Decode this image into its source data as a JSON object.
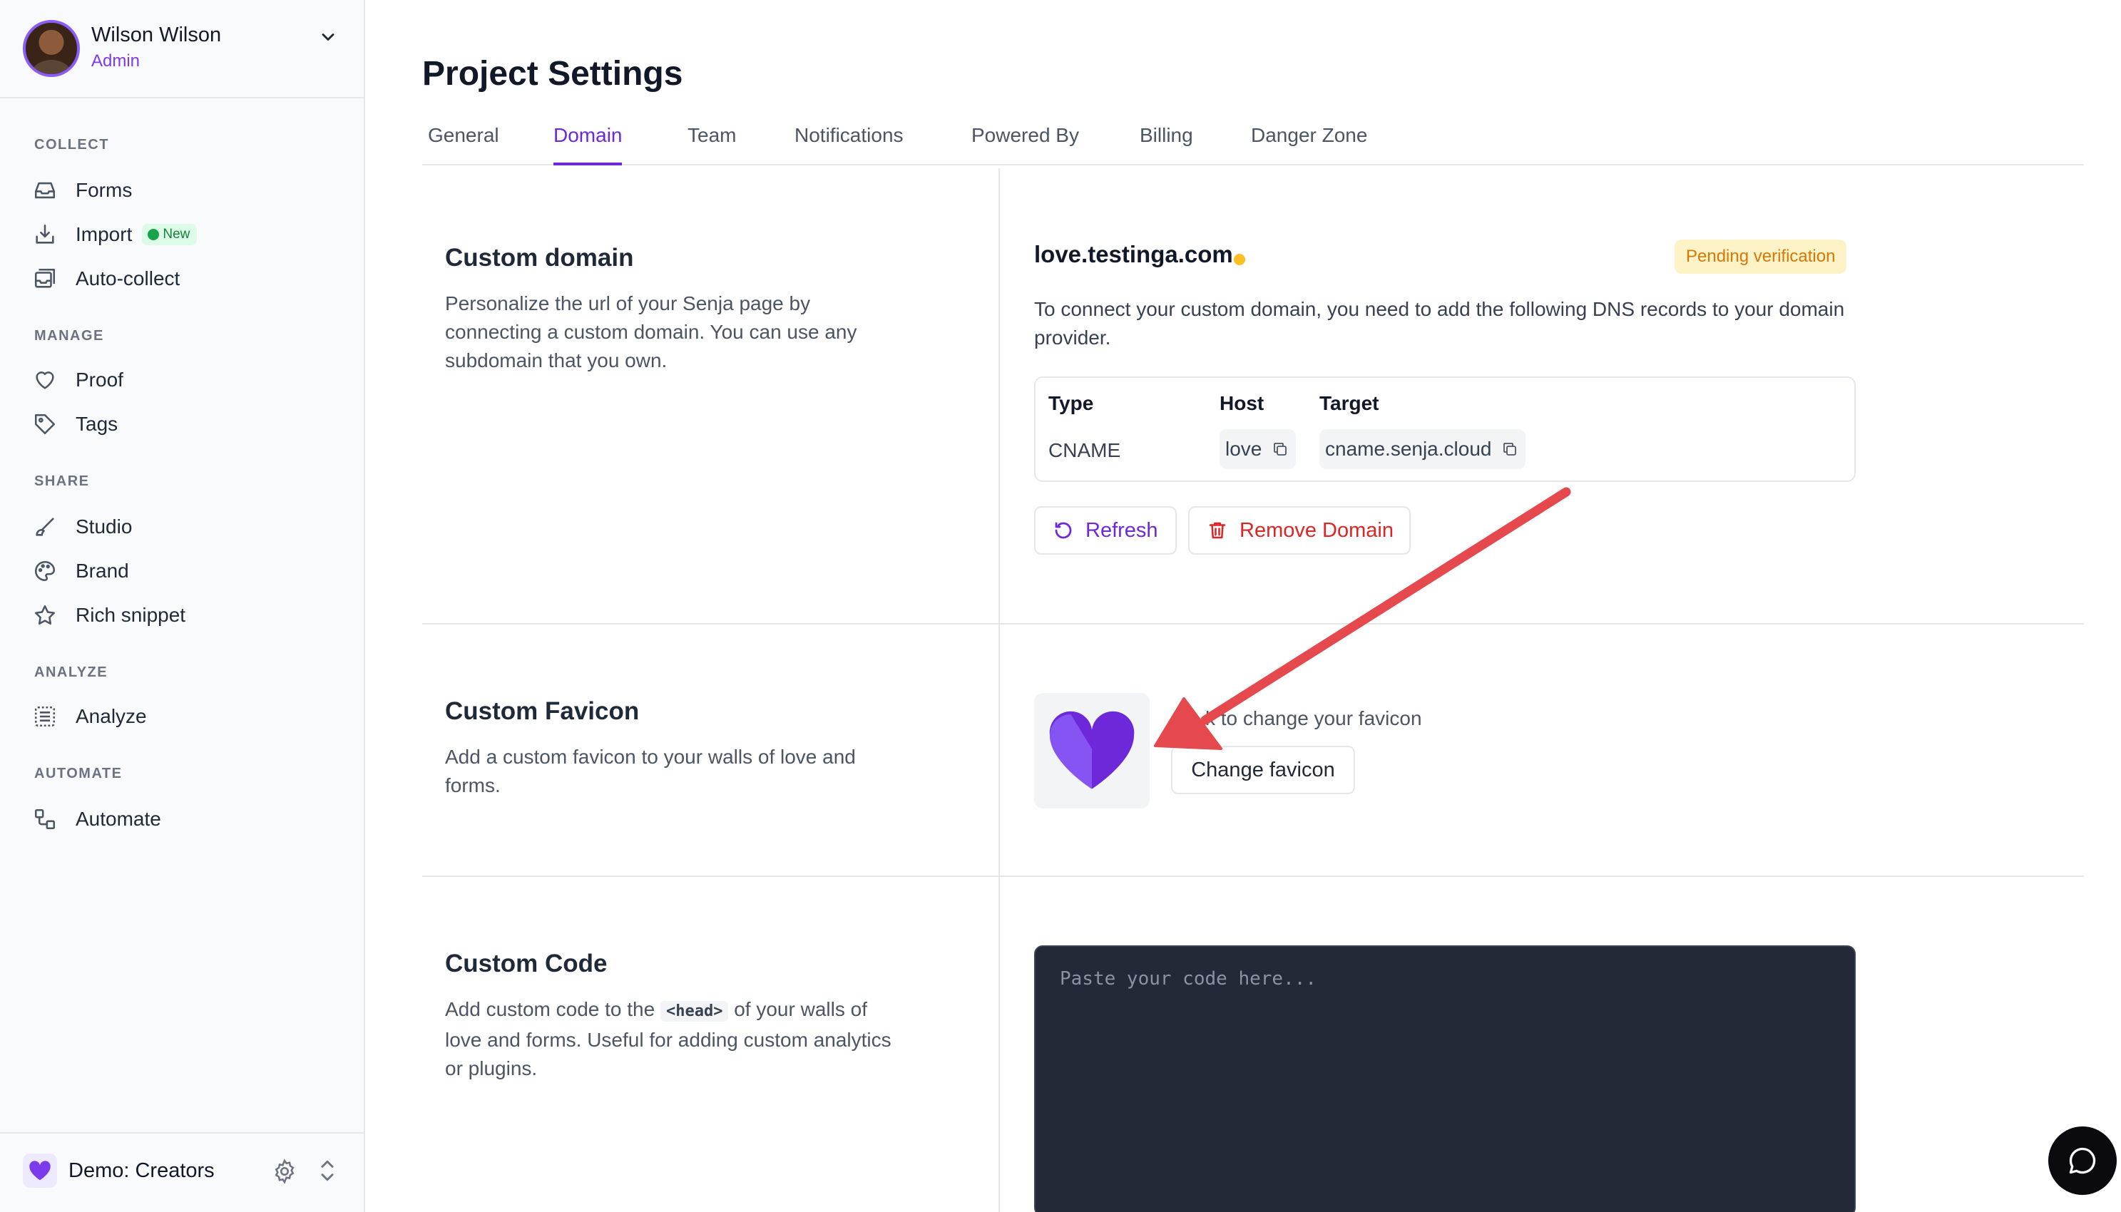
{
  "user": {
    "name": "Wilson Wilson",
    "role": "Admin"
  },
  "sidebar": {
    "sections": [
      {
        "label": "COLLECT"
      },
      {
        "label": "MANAGE"
      },
      {
        "label": "SHARE"
      },
      {
        "label": "ANALYZE"
      },
      {
        "label": "AUTOMATE"
      }
    ],
    "items": [
      {
        "label": "Forms",
        "icon": "inbox-icon"
      },
      {
        "label": "Import",
        "icon": "import-icon",
        "badge": "New"
      },
      {
        "label": "Auto-collect",
        "icon": "auto-collect-icon"
      },
      {
        "label": "Proof",
        "icon": "heart-icon"
      },
      {
        "label": "Tags",
        "icon": "tag-icon"
      },
      {
        "label": "Studio",
        "icon": "brush-icon"
      },
      {
        "label": "Brand",
        "icon": "palette-icon"
      },
      {
        "label": "Rich snippet",
        "icon": "star-icon"
      },
      {
        "label": "Analyze",
        "icon": "analyze-icon"
      },
      {
        "label": "Automate",
        "icon": "automate-icon"
      }
    ],
    "workspace": {
      "name": "Demo: Creators"
    }
  },
  "page": {
    "title": "Project Settings",
    "tabs": [
      {
        "label": "General"
      },
      {
        "label": "Domain",
        "active": true
      },
      {
        "label": "Team"
      },
      {
        "label": "Notifications"
      },
      {
        "label": "Powered By"
      },
      {
        "label": "Billing"
      },
      {
        "label": "Danger Zone"
      }
    ]
  },
  "custom_domain": {
    "title": "Custom domain",
    "description": "Personalize the url of your Senja page by connecting a custom domain. You can use any subdomain that you own.",
    "domain": "love.testinga.com",
    "status": "Pending verification",
    "instructions": "To connect your custom domain, you need to add the following DNS records to your domain provider.",
    "dns": {
      "headers": {
        "type": "Type",
        "host": "Host",
        "target": "Target"
      },
      "record": {
        "type": "CNAME",
        "host": "love",
        "target": "cname.senja.cloud"
      }
    },
    "refresh_label": "Refresh",
    "remove_label": "Remove Domain"
  },
  "custom_favicon": {
    "title": "Custom Favicon",
    "description": "Add a custom favicon to your walls of love and forms.",
    "hint": "k to change your favicon",
    "button_label": "Change favicon"
  },
  "custom_code": {
    "title": "Custom Code",
    "desc_before": "Add custom code to the ",
    "desc_code": "<head>",
    "desc_after": " of your walls of love and forms. Useful for adding custom analytics or plugins.",
    "placeholder": "Paste your code here..."
  },
  "colors": {
    "accent": "#6d28d9",
    "danger": "#dc2626",
    "pending_bg": "#fef3c7",
    "pending_text": "#d97706",
    "arrow": "#e5484d"
  }
}
